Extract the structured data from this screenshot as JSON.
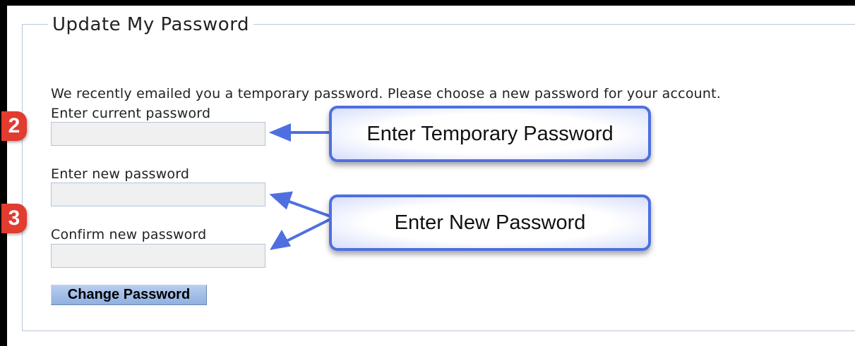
{
  "form": {
    "legend": "Update My Password",
    "intro": "We recently emailed you a temporary password. Please choose a new password for your account.",
    "current_password_label": "Enter current password",
    "new_password_label": "Enter new password",
    "confirm_password_label": "Confirm new password",
    "current_password_value": "",
    "new_password_value": "",
    "confirm_password_value": "",
    "submit_label": "Change Password"
  },
  "annotations": {
    "step_2": "2",
    "step_3": "3",
    "callout_temporary": "Enter Temporary Password",
    "callout_new": "Enter New Password",
    "accent_color": "#4f6fe0",
    "badge_color": "#e23b30"
  }
}
